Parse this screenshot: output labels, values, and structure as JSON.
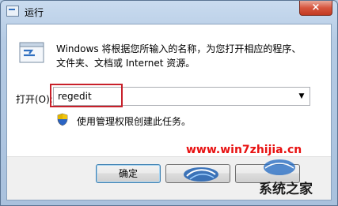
{
  "window": {
    "title": "运行",
    "close_label": "×"
  },
  "description": {
    "line1": "Windows 将根据您所输入的名称，为您打开相应的程序、",
    "line2": "文件夹、文档或 Internet 资源。"
  },
  "open": {
    "label": "打开(O):",
    "value": "regedit"
  },
  "admin_note": "使用管理权限创建此任务。",
  "buttons": {
    "ok": "确定"
  },
  "watermark": {
    "url": "www.win7zhijia.cn",
    "brand": "系统之家"
  },
  "colors": {
    "highlight": "#c8202a",
    "watermark_url": "#e81111"
  },
  "icons": [
    "run-icon",
    "shield-icon",
    "chevron-down-icon",
    "close-icon"
  ]
}
